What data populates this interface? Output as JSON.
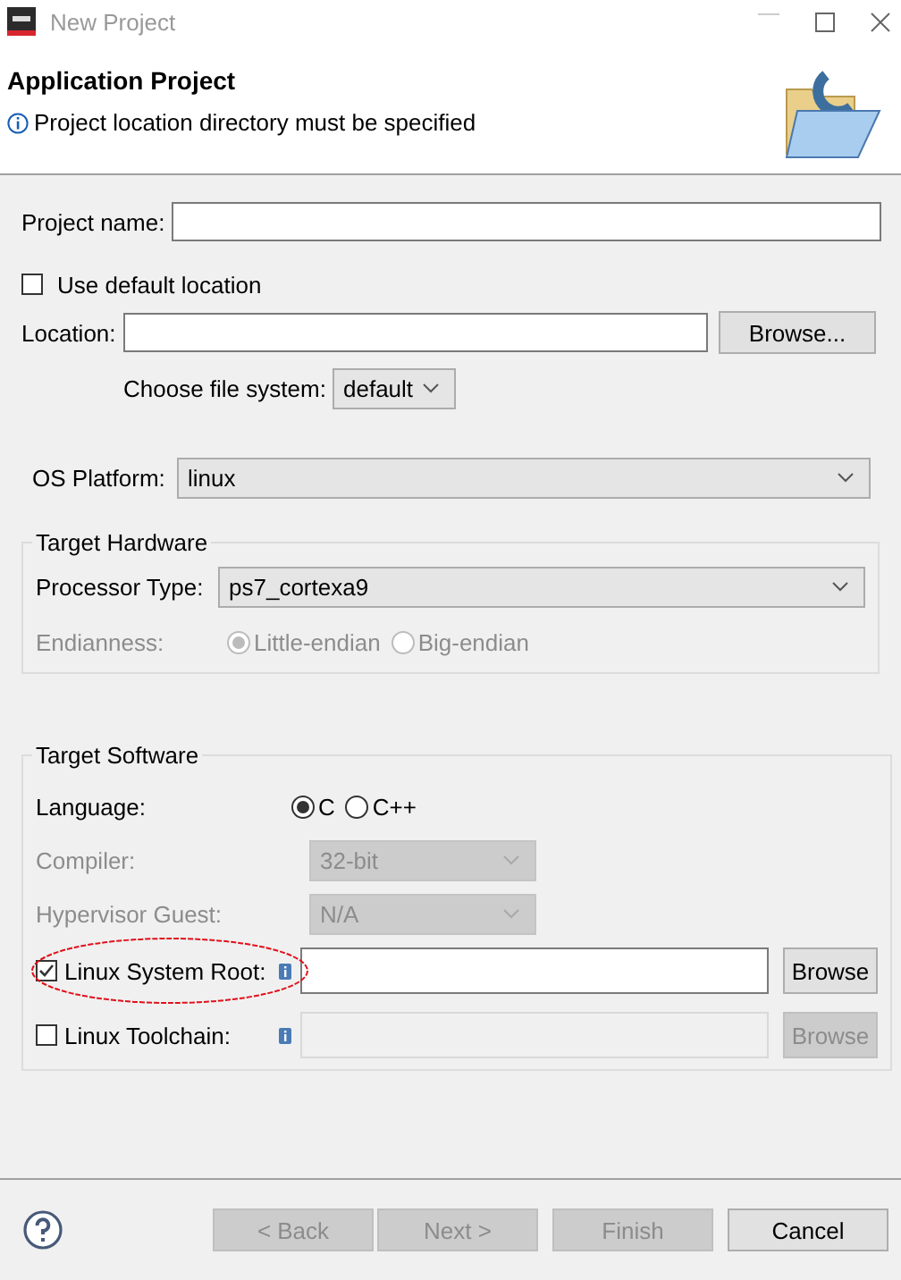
{
  "window": {
    "title": "New Project"
  },
  "header": {
    "title": "Application Project",
    "message": "Project location directory must be specified"
  },
  "project_name": {
    "label": "Project name:"
  },
  "use_default_location": {
    "label": "Use default location",
    "checked": false
  },
  "location": {
    "label": "Location:",
    "button": "Browse..."
  },
  "file_system": {
    "label": "Choose file system:",
    "value": "default"
  },
  "os_platform": {
    "label": "OS Platform:",
    "value": "linux"
  },
  "target_hardware": {
    "title": "Target Hardware",
    "processor_type": {
      "label": "Processor Type:",
      "value": "ps7_cortexa9"
    },
    "endianness": {
      "label": "Endianness:",
      "disabled": true,
      "options": [
        {
          "label": "Little-endian",
          "selected": true
        },
        {
          "label": "Big-endian",
          "selected": false
        }
      ]
    }
  },
  "target_software": {
    "title": "Target Software",
    "language": {
      "label": "Language:",
      "options": [
        {
          "label": "C",
          "selected": true
        },
        {
          "label": "C++",
          "selected": false
        }
      ]
    },
    "compiler": {
      "label": "Compiler:",
      "value": "32-bit",
      "disabled": true
    },
    "hypervisor_guest": {
      "label": "Hypervisor Guest:",
      "value": "N/A",
      "disabled": true
    },
    "linux_system_root": {
      "label": "Linux System Root:",
      "checked": true,
      "circled": true,
      "button": "Browse"
    },
    "linux_toolchain": {
      "label": "Linux Toolchain:",
      "checked": false,
      "button": "Browse"
    }
  },
  "buttons": [
    {
      "label": "< Back",
      "disabled": true
    },
    {
      "label": "Next >",
      "disabled": true
    },
    {
      "label": "Finish",
      "disabled": true
    },
    {
      "label": "Cancel",
      "disabled": false
    }
  ]
}
